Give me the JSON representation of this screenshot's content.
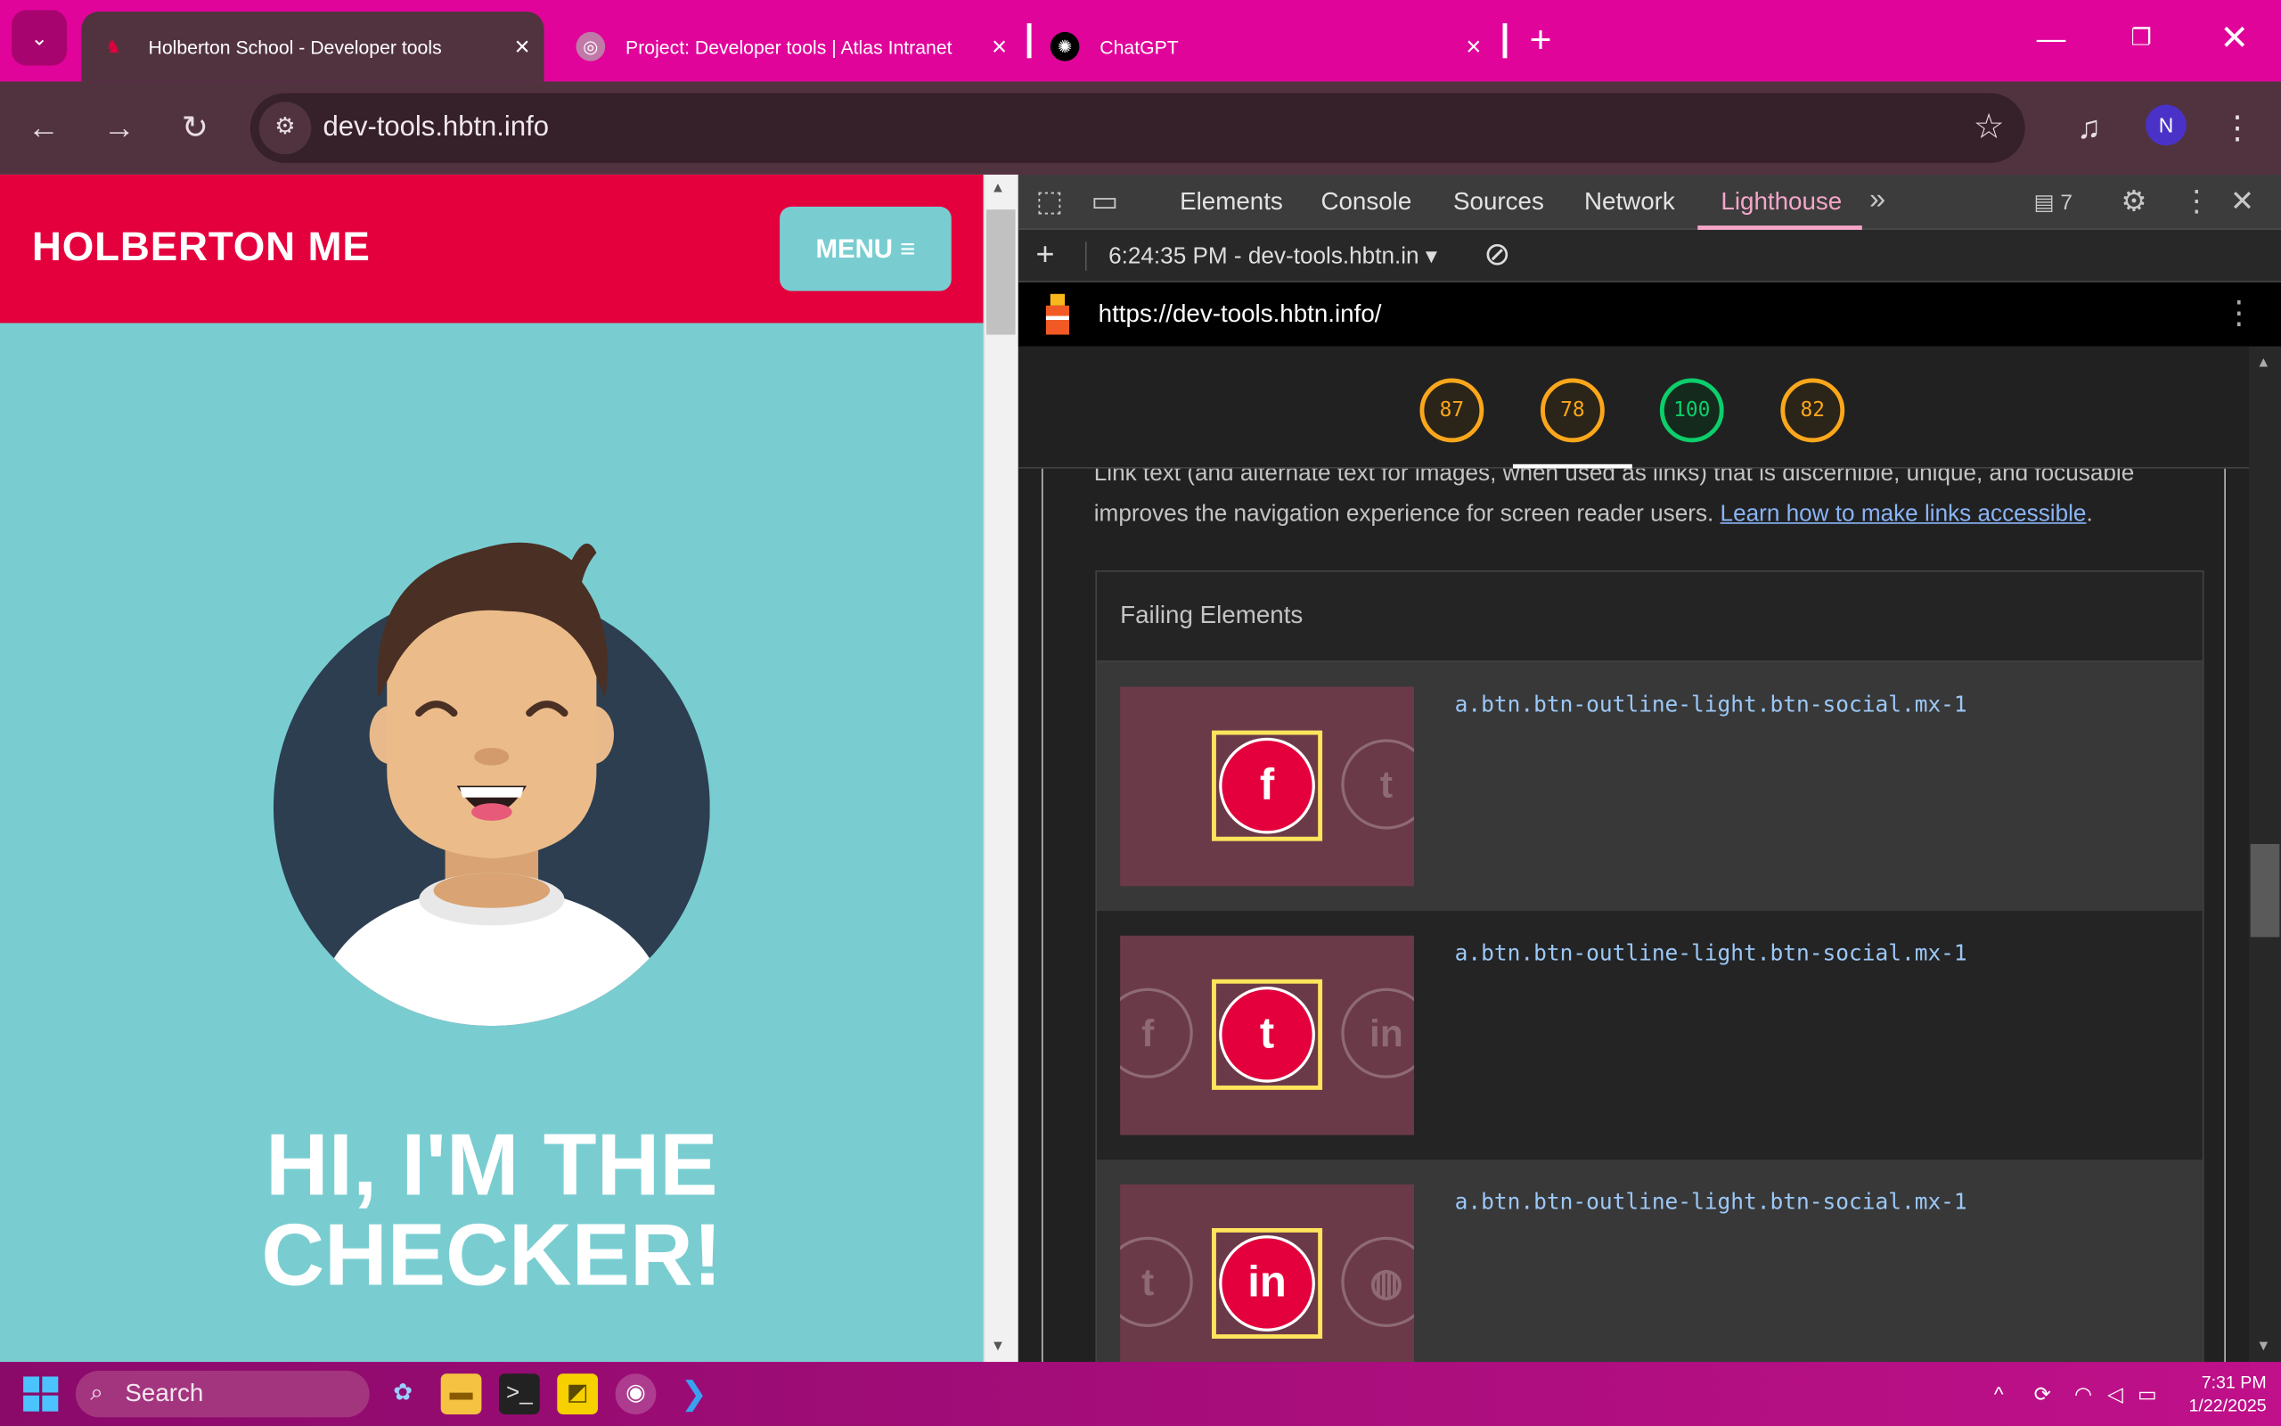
{
  "browser": {
    "tabs": [
      {
        "title": "Holberton School - Developer tools",
        "active": true
      },
      {
        "title": "Project: Developer tools | Atlas Intranet",
        "active": false
      },
      {
        "title": "ChatGPT",
        "active": false
      }
    ],
    "new_tab_label": "+",
    "address": "dev-tools.hbtn.info",
    "profile_initial": "N"
  },
  "page": {
    "brand": "HOLBERTON ME",
    "menu_label": "MENU ≡",
    "hero_line1": "HI, I'M THE",
    "hero_line2": "CHECKER!"
  },
  "devtools": {
    "tabs": [
      "Elements",
      "Console",
      "Sources",
      "Network",
      "Lighthouse"
    ],
    "selected_tab": "Lighthouse",
    "issues_count": "7",
    "report_selector": "6:24:35 PM - dev-tools.hbtn.in",
    "report_url": "https://dev-tools.hbtn.info/",
    "scores": [
      {
        "value": "87",
        "status": "average"
      },
      {
        "value": "78",
        "status": "average"
      },
      {
        "value": "100",
        "status": "pass"
      },
      {
        "value": "82",
        "status": "average"
      }
    ],
    "colors": {
      "average": "#fba71b",
      "pass": "#0cce6b",
      "accent": "#f5a6c8"
    },
    "audit_text_1": "Link text (and alternate text for images, when used as links) that is discernible, unique, and focusable",
    "audit_text_2": "improves the navigation experience for screen reader users.",
    "audit_link": "Learn how to make links accessible",
    "audit_text_end": ".",
    "failing_header": "Failing Elements",
    "failing_items": [
      {
        "selector": "a.btn.btn-outline-light.btn-social.mx-1",
        "icon": "facebook-icon"
      },
      {
        "selector": "a.btn.btn-outline-light.btn-social.mx-1",
        "icon": "twitter-icon"
      },
      {
        "selector": "a.btn.btn-outline-light.btn-social.mx-1",
        "icon": "linkedin-icon"
      }
    ]
  },
  "taskbar": {
    "search_label": "Search",
    "time": "7:31 PM",
    "date": "1/22/2025"
  }
}
